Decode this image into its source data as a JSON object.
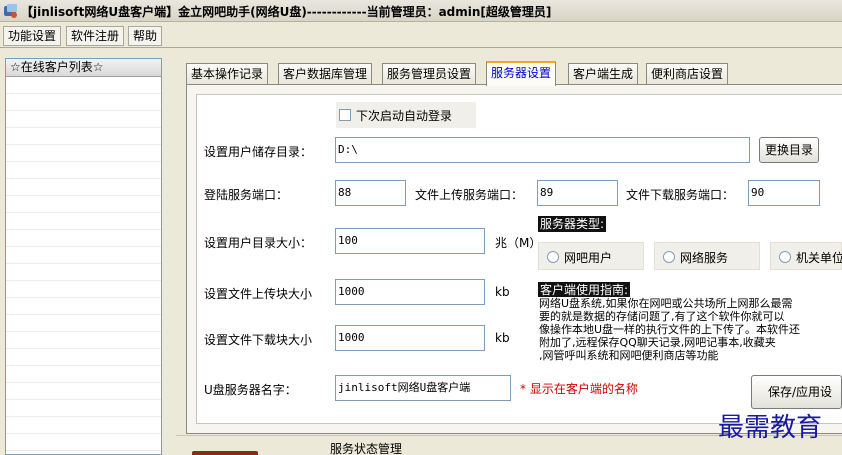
{
  "titlebar": {
    "title": "【jinlisoft网络U盘客户端】金立网吧助手(网络U盘)------------当前管理员：admin[超级管理员]",
    "icon": "app-icon"
  },
  "menu": {
    "items": [
      "功能设置",
      "软件注册",
      "帮助"
    ]
  },
  "left_panel": {
    "header": "☆在线客户列表☆"
  },
  "tabs": {
    "items": [
      "基本操作记录",
      "客户数据库管理",
      "服务管理员设置",
      "服务器设置",
      "客户端生成",
      "便利商店设置"
    ],
    "active": "服务器设置"
  },
  "form": {
    "auto_login_label": "下次启动自动登录",
    "storage_dir_label": "设置用户储存目录：",
    "storage_dir_value": "D:\\",
    "change_dir_button": "更换目录",
    "login_port_label": "登陆服务端口：",
    "login_port_value": "88",
    "upload_port_label": "文件上传服务端口：",
    "upload_port_value": "89",
    "download_port_label": "文件下载服务端口：",
    "download_port_value": "90",
    "dir_size_label": "设置用户目录大小：",
    "dir_size_value": "100",
    "dir_size_unit": "兆（M）",
    "upload_block_label": "设置文件上传块大小",
    "upload_block_value": "1000",
    "upload_block_unit": "kb",
    "download_block_label": "设置文件下载块大小",
    "download_block_value": "1000",
    "download_block_unit": "kb",
    "server_name_label": "U盘服务器名字：",
    "server_name_value": "jinlisoft网络U盘客户端",
    "server_name_note": "* 显示在客户端的名称",
    "save_button": "保存/应用设"
  },
  "server_type": {
    "title": "服务器类型:",
    "options": [
      "网吧用户",
      "网络服务",
      "机关单位"
    ]
  },
  "guide": {
    "title": "客户端使用指南:",
    "lines": [
      "网络U盘系统,如果你在网吧或公共场所上网那么最需",
      "要的就是数据的存储问题了,有了这个软件你就可以",
      "像操作本地U盘一样的执行文件的上下传了。本软件还",
      "附加了,远程保存QQ聊天记录,网吧记事本,收藏夹",
      ",网管呼叫系统和网吧便利商店等功能"
    ]
  },
  "bottom": {
    "section_label": "服务状态管理"
  },
  "watermark": {
    "text": "最需教育"
  },
  "colors": {
    "accent_tab_text": "#0000c8",
    "tab_highlight": "#f5a623",
    "note_red": "#d00000",
    "guide_title_bg": "#111111"
  }
}
